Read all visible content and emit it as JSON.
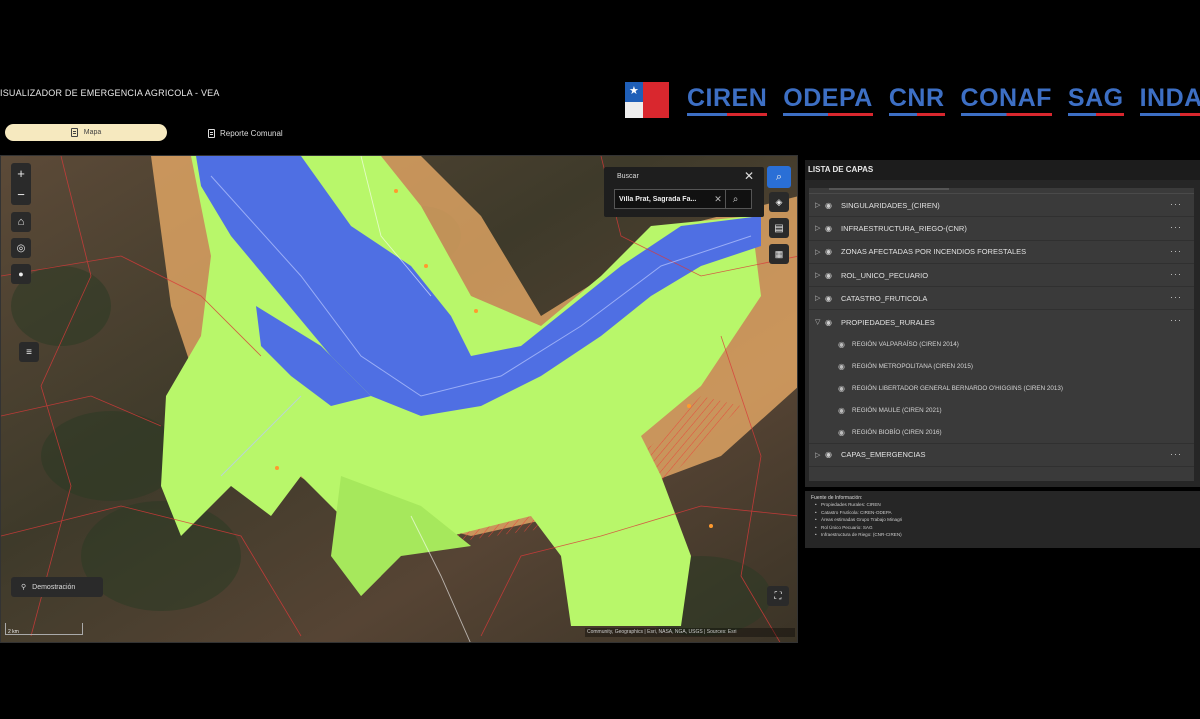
{
  "app": {
    "title": "ISUALIZADOR DE EMERGENCIA AGRICOLA - VEA"
  },
  "logos": {
    "gov_text": "Gobierno de Chile",
    "agencies": [
      "CIREN",
      "ODEPA",
      "CNR",
      "CONAF",
      "SAG",
      "INDAP"
    ]
  },
  "tabs": {
    "map": "Mapa",
    "report": "Reporte Comunal"
  },
  "search": {
    "title": "Buscar",
    "value": "Villa Prat, Sagrada Fa..."
  },
  "map": {
    "demo_label": "Demostración",
    "scale_label": "2 km",
    "attribution": "Community, Geographics | Esri, NASA, NGA, USGS | Sources: Esri"
  },
  "layers_panel": {
    "title": "LISTA DE CAPAS",
    "layers": [
      {
        "label": "SINGULARIDADES_(CIREN)",
        "expanded": false
      },
      {
        "label": "INFRAESTRUCTURA_RIEGO-(CNR)",
        "expanded": false
      },
      {
        "label": "ZONAS AFECTADAS POR INCENDIOS FORESTALES",
        "expanded": false
      },
      {
        "label": "ROL_UNICO_PECUARIO",
        "expanded": false
      },
      {
        "label": "CATASTRO_FRUTICOLA",
        "expanded": false
      },
      {
        "label": "PROPIEDADES_RURALES",
        "expanded": true
      }
    ],
    "sublayers": [
      "REGIÓN VALPARAÍSO (CIREN 2014)",
      "REGIÓN METROPOLITANA (CIREN 2015)",
      "REGIÓN LIBERTADOR GENERAL BERNARDO O'HIGGINS (CIREN 2013)",
      "REGIÓN MAULE (CIREN 2021)",
      "REGIÓN BIOBÍO (CIREN 2016)"
    ],
    "last_layer": "CAPAS_EMERGENCIAS",
    "more_glyph": "···"
  },
  "sources": {
    "title": "Fuente de Información:",
    "items": [
      "Propiedades Rurales: CIREN",
      "Catastro Frutícola: CIREN-ODEPA",
      "Áreas estimadas Grupo Trabajo Minagri",
      "Rol Único Pecuario: SAG",
      "Infraestructura de Riego: (CNR-CIREN)"
    ]
  },
  "colors": {
    "agency_blue": "#3d6fc4",
    "agency_red": "#d9272e",
    "tab_active_bg": "#f6e9bf",
    "flood_blue": "#4f6fe3",
    "affected_green": "#b8f76a",
    "buffer_orange": "#f0b06a"
  },
  "icons": [
    "zoom-in-icon",
    "zoom-out-icon",
    "home-icon",
    "locate-icon",
    "mic-icon",
    "list-icon",
    "search-icon",
    "close-icon",
    "basemap-icon",
    "table-icon",
    "print-icon",
    "fullscreen-icon",
    "pin-icon",
    "eye-icon",
    "caret-icon",
    "more-icon"
  ]
}
